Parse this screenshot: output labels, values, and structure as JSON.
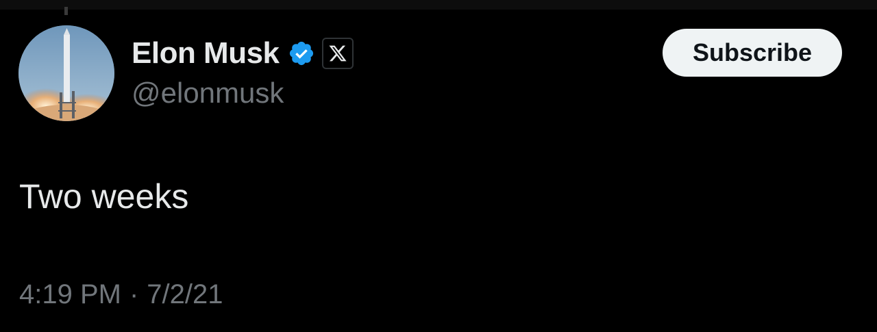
{
  "tweet": {
    "author": {
      "display_name": "Elon Musk",
      "handle": "@elonmusk",
      "verified_icon": "verified-check-icon",
      "affiliate_icon": "x-logo-icon",
      "verified_color": "#1d9bf0"
    },
    "subscribe_label": "Subscribe",
    "text": "Two weeks",
    "time": "4:19 PM",
    "separator": "·",
    "date": "7/2/21"
  },
  "colors": {
    "background": "#000000",
    "primary_text": "#e7e9ea",
    "secondary_text": "#71767b",
    "button_bg": "#eff3f4",
    "button_text": "#0f1419"
  }
}
